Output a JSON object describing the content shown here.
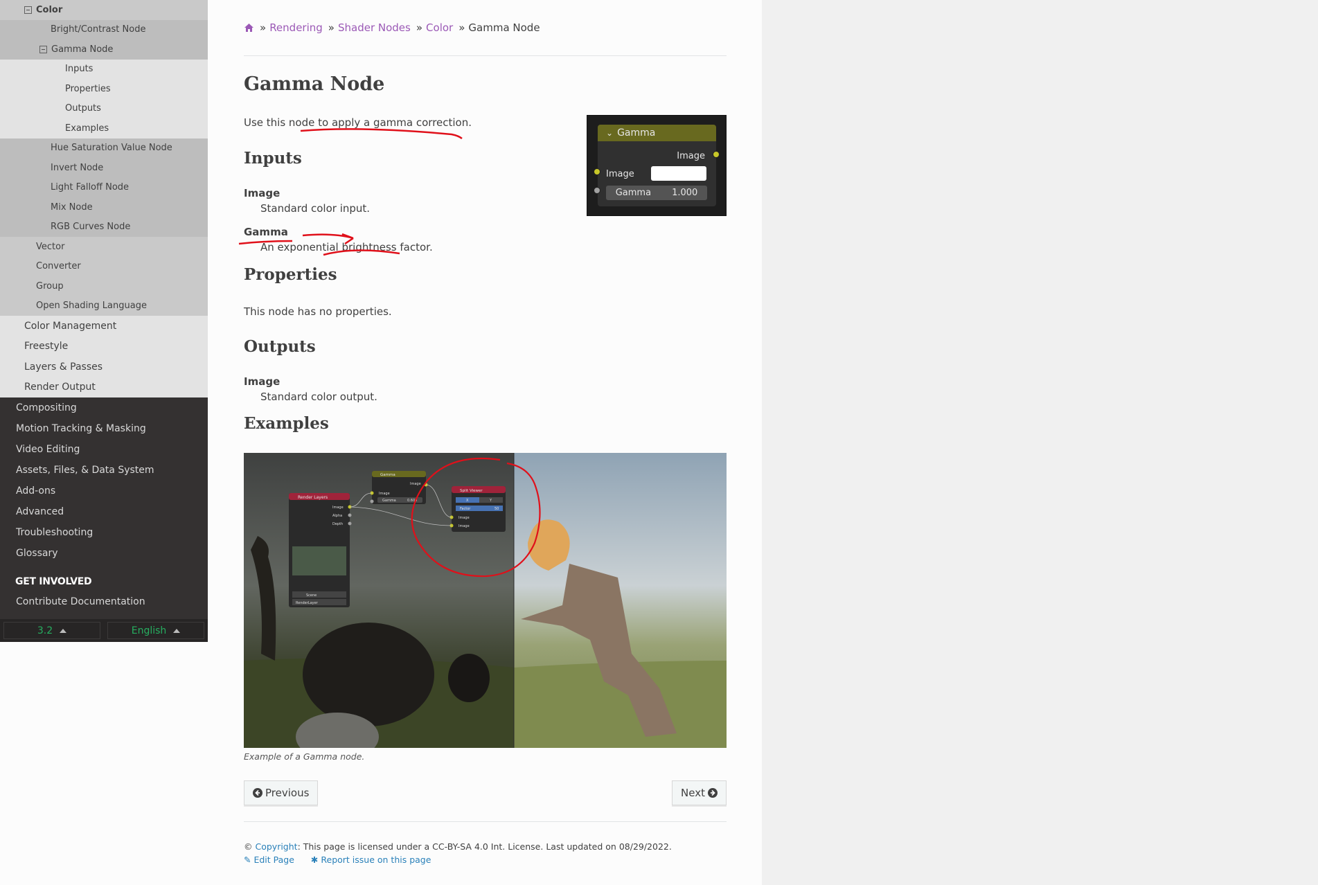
{
  "sidebar": {
    "items": [
      {
        "label": "Color",
        "level": "l2",
        "current": true,
        "toggle": true
      },
      {
        "label": "Bright/Contrast Node",
        "level": "l3"
      },
      {
        "label": "Gamma Node",
        "level": "l3cur",
        "toggle": true
      },
      {
        "label": "Inputs",
        "level": "l4"
      },
      {
        "label": "Properties",
        "level": "l4"
      },
      {
        "label": "Outputs",
        "level": "l4"
      },
      {
        "label": "Examples",
        "level": "l4"
      },
      {
        "label": "Hue Saturation Value Node",
        "level": "l3"
      },
      {
        "label": "Invert Node",
        "level": "l3"
      },
      {
        "label": "Light Falloff Node",
        "level": "l3"
      },
      {
        "label": "Mix Node",
        "level": "l3"
      },
      {
        "label": "RGB Curves Node",
        "level": "l3"
      },
      {
        "label": "Vector",
        "level": "l2b"
      },
      {
        "label": "Converter",
        "level": "l2b"
      },
      {
        "label": "Group",
        "level": "l2b"
      },
      {
        "label": "Open Shading Language",
        "level": "l2b"
      },
      {
        "label": "Color Management",
        "level": "l1"
      },
      {
        "label": "Freestyle",
        "level": "l1"
      },
      {
        "label": "Layers & Passes",
        "level": "l1"
      },
      {
        "label": "Render Output",
        "level": "l1"
      }
    ],
    "top_items": [
      "Compositing",
      "Motion Tracking & Masking",
      "Video Editing",
      "Assets, Files, & Data System",
      "Add-ons",
      "Advanced",
      "Troubleshooting",
      "Glossary"
    ],
    "caption": "Get Involved",
    "contribute": "Contribute Documentation",
    "version": "3.2",
    "language": "English"
  },
  "breadcrumb": {
    "items": [
      "Rendering",
      "Shader Nodes",
      "Color"
    ],
    "current": "Gamma Node"
  },
  "page": {
    "title": "Gamma Node",
    "intro": "Use this node to apply a gamma correction.",
    "inputs_heading": "Inputs",
    "inputs": [
      {
        "term": "Image",
        "desc": "Standard color input."
      },
      {
        "term": "Gamma",
        "desc": "An exponential brightness factor."
      }
    ],
    "properties_heading": "Properties",
    "properties_text": "This node has no properties.",
    "outputs_heading": "Outputs",
    "outputs": [
      {
        "term": "Image",
        "desc": "Standard color output."
      }
    ],
    "examples_heading": "Examples",
    "caption": "Example of a Gamma node."
  },
  "node": {
    "header": "Gamma",
    "output_label": "Image",
    "input_image_label": "Image",
    "gamma_label": "Gamma",
    "gamma_value": "1.000"
  },
  "example_nodes": {
    "render_layers": "Render Layers",
    "gamma": "Gamma",
    "gamma_value": "0.600",
    "split_viewer": "Split Viewer",
    "factor": "Factor",
    "factor_value": "50",
    "sockets": [
      "Image",
      "Alpha",
      "Depth"
    ],
    "scene": "Scene",
    "layer": "RenderLayer",
    "x": "X",
    "y": "Y",
    "image": "Image"
  },
  "nav": {
    "previous": "Previous",
    "next": "Next"
  },
  "footer": {
    "copyright_prefix": "©",
    "copyright_link": "Copyright",
    "license": ": This page is licensed under a CC-BY-SA 4.0 Int. License. Last updated on 08/29/2022.",
    "edit": "Edit Page",
    "report": "Report issue on this page"
  },
  "colors": {
    "link_purple": "#9b59b6",
    "link_blue": "#2980b9",
    "annotation_red": "#e0101a",
    "node_header": "#68691f",
    "socket_yellow": "#c7c729"
  }
}
